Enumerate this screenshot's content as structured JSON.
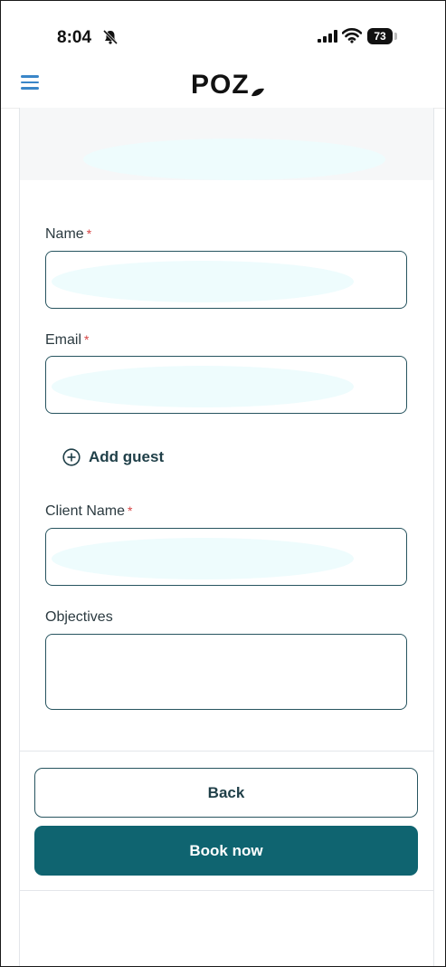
{
  "status_bar": {
    "time": "8:04",
    "battery": "73"
  },
  "header": {
    "logo_text": "POZ"
  },
  "form": {
    "name": {
      "label": "Name",
      "required_mark": "*"
    },
    "email": {
      "label": "Email",
      "required_mark": "*"
    },
    "add_guest_label": "Add guest",
    "client_name": {
      "label": "Client Name",
      "required_mark": "*"
    },
    "objectives": {
      "label": "Objectives"
    }
  },
  "actions": {
    "back_label": "Back",
    "book_label": "Book now"
  },
  "icons": {
    "menu": "hamburger-menu-icon",
    "add_guest": "plus-circle-icon",
    "status": [
      "bell-slash-icon",
      "cellular-signal-icon",
      "wifi-icon",
      "battery-icon"
    ]
  },
  "colors": {
    "accent": "#0f6470",
    "input_border": "#27545f",
    "required": "#d64545",
    "menu_icon": "#3a86c8",
    "redaction": "#eefcfd"
  }
}
